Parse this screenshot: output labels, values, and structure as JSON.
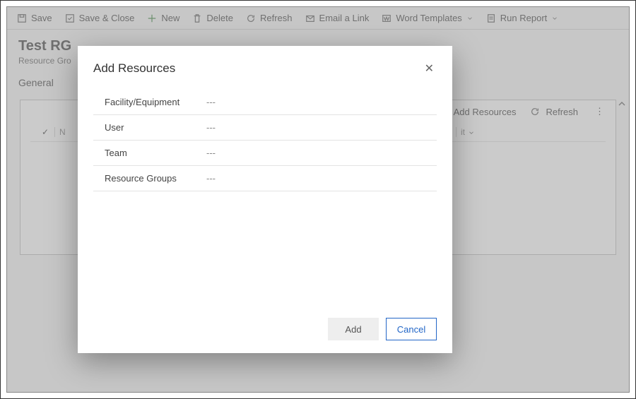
{
  "toolbar": {
    "save": "Save",
    "save_close": "Save & Close",
    "new": "New",
    "delete": "Delete",
    "refresh": "Refresh",
    "email_link": "Email a Link",
    "word_templates": "Word Templates",
    "run_report": "Run Report"
  },
  "header": {
    "title": "Test RG",
    "subtitle": "Resource Gro",
    "tab_general": "General"
  },
  "panel": {
    "add_resources": "Add Resources",
    "refresh": "Refresh",
    "col_name_partial": "N",
    "col_unit_partial": "it"
  },
  "modal": {
    "title": "Add Resources",
    "fields": {
      "facility_equipment": {
        "label": "Facility/Equipment",
        "value": "---"
      },
      "user": {
        "label": "User",
        "value": "---"
      },
      "team": {
        "label": "Team",
        "value": "---"
      },
      "resource_groups": {
        "label": "Resource Groups",
        "value": "---"
      }
    },
    "add_label": "Add",
    "cancel_label": "Cancel"
  }
}
